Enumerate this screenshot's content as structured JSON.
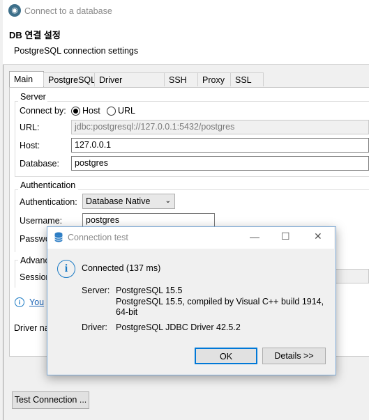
{
  "window": {
    "title": "Connect to a database",
    "header_title": "DB 연결 설정",
    "header_subtitle": "PostgreSQL connection settings"
  },
  "tabs": [
    "Main",
    "PostgreSQL",
    "Driver properties",
    "SSH",
    "Proxy",
    "SSL"
  ],
  "server": {
    "group_label": "Server",
    "connect_by_label": "Connect by:",
    "option_host": "Host",
    "option_url": "URL",
    "selected": "Host",
    "url_label": "URL:",
    "url_value": "jdbc:postgresql://127.0.0.1:5432/postgres",
    "host_label": "Host:",
    "host_value": "127.0.0.1",
    "database_label": "Database:",
    "database_value": "postgres"
  },
  "auth": {
    "group_label": "Authentication",
    "auth_label": "Authentication:",
    "auth_value": "Database Native",
    "username_label": "Username:",
    "username_value": "postgres",
    "password_label_partial": "Passwo"
  },
  "advanced": {
    "group_label_partial": "Advanc",
    "session_label_partial": "Session"
  },
  "info_link_partial": "You",
  "driver_label_partial": "Driver na",
  "test_connection_label": "Test Connection ...",
  "dialog": {
    "title": "Connection test",
    "status": "Connected (137 ms)",
    "server_label": "Server:",
    "server_line1": "PostgreSQL 15.5",
    "server_line2": "PostgreSQL 15.5, compiled by Visual C++ build 1914,",
    "server_line3": "64-bit",
    "driver_label": "Driver:",
    "driver_value": "PostgreSQL JDBC Driver 42.5.2",
    "ok_label": "OK",
    "details_label": "Details >>"
  }
}
